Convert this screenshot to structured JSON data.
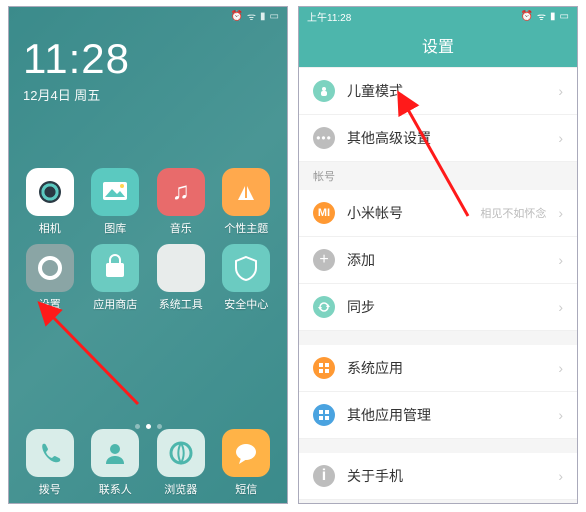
{
  "left": {
    "time": "11:28",
    "date": "12月4日 周五",
    "apps_row1": [
      {
        "label": "相机",
        "name": "camera"
      },
      {
        "label": "图库",
        "name": "gallery"
      },
      {
        "label": "音乐",
        "name": "music"
      },
      {
        "label": "个性主题",
        "name": "theme"
      }
    ],
    "apps_row2": [
      {
        "label": "设置",
        "name": "settings"
      },
      {
        "label": "应用商店",
        "name": "store"
      },
      {
        "label": "系统工具",
        "name": "tools"
      },
      {
        "label": "安全中心",
        "name": "security"
      }
    ],
    "dock": [
      {
        "label": "拨号",
        "name": "dialer"
      },
      {
        "label": "联系人",
        "name": "contacts"
      },
      {
        "label": "浏览器",
        "name": "browser"
      },
      {
        "label": "短信",
        "name": "sms"
      }
    ]
  },
  "right": {
    "status_time": "上午11:28",
    "title": "设置",
    "top_rows": [
      {
        "label": "儿童模式",
        "icon_color": "#7dd3c0",
        "icon": "child"
      },
      {
        "label": "其他高级设置",
        "icon_color": "#bdbdbd",
        "icon": "more"
      }
    ],
    "account_header": "帐号",
    "account_rows": [
      {
        "label": "小米帐号",
        "sub": "相见不如怀念",
        "icon_color": "#ff9933",
        "icon": "mi"
      },
      {
        "label": "添加",
        "icon_color": "#bdbdbd",
        "icon": "plus"
      },
      {
        "label": "同步",
        "icon_color": "#7dd3c0",
        "icon": "sync"
      }
    ],
    "system_rows": [
      {
        "label": "系统应用",
        "icon_color": "#ff9933",
        "icon": "sysapp"
      },
      {
        "label": "其他应用管理",
        "icon_color": "#4aa3e0",
        "icon": "appmgr"
      }
    ],
    "about_rows": [
      {
        "label": "关于手机",
        "icon_color": "#bdbdbd",
        "icon": "about"
      }
    ]
  }
}
